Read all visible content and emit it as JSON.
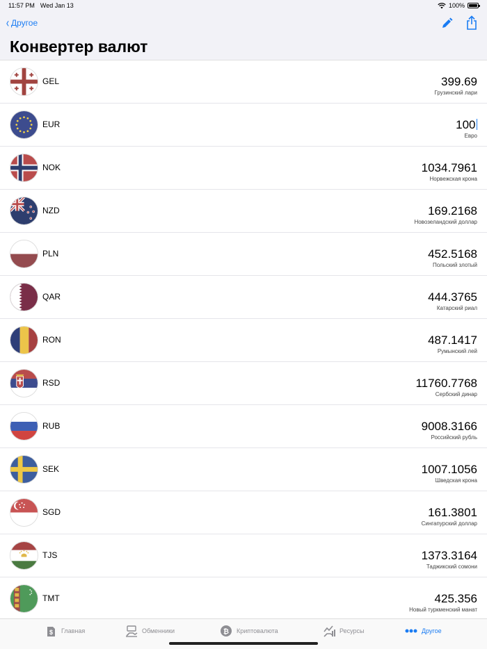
{
  "status": {
    "time": "11:57 PM",
    "date": "Wed Jan 13",
    "battery": "100%"
  },
  "nav": {
    "back_label": "Другое",
    "title": "Конвертер валют"
  },
  "currencies": [
    {
      "code": "GEL",
      "value": "399.69",
      "name": "Грузинский лари",
      "flag": "georgia-flag-icon"
    },
    {
      "code": "EUR",
      "value": "100",
      "name": "Евро",
      "flag": "eu-flag-icon",
      "editing": true
    },
    {
      "code": "NOK",
      "value": "1034.7961",
      "name": "Норвежская крона",
      "flag": "norway-flag-icon"
    },
    {
      "code": "NZD",
      "value": "169.2168",
      "name": "Новозеландский доллар",
      "flag": "new-zealand-flag-icon"
    },
    {
      "code": "PLN",
      "value": "452.5168",
      "name": "Польский злотый",
      "flag": "poland-flag-icon"
    },
    {
      "code": "QAR",
      "value": "444.3765",
      "name": "Катарский риал",
      "flag": "qatar-flag-icon"
    },
    {
      "code": "RON",
      "value": "487.1417",
      "name": "Румынский лей",
      "flag": "romania-flag-icon"
    },
    {
      "code": "RSD",
      "value": "11760.7768",
      "name": "Сербский динар",
      "flag": "serbia-flag-icon"
    },
    {
      "code": "RUB",
      "value": "9008.3166",
      "name": "Российский рубль",
      "flag": "russia-flag-icon"
    },
    {
      "code": "SEK",
      "value": "1007.1056",
      "name": "Шведская крона",
      "flag": "sweden-flag-icon"
    },
    {
      "code": "SGD",
      "value": "161.3801",
      "name": "Сингапурский доллар",
      "flag": "singapore-flag-icon"
    },
    {
      "code": "TJS",
      "value": "1373.3164",
      "name": "Таджикский сомони",
      "flag": "tajikistan-flag-icon"
    },
    {
      "code": "TMT",
      "value": "425.356",
      "name": "Новый туркменский манат",
      "flag": "turkmenistan-flag-icon"
    }
  ],
  "tabs": [
    {
      "label": "Главная",
      "icon": "dollar-doc-icon"
    },
    {
      "label": "Обменники",
      "icon": "exchange-hand-icon"
    },
    {
      "label": "Криптовалюта",
      "icon": "bitcoin-icon"
    },
    {
      "label": "Ресурсы",
      "icon": "chart-hand-icon"
    },
    {
      "label": "Другое",
      "icon": "more-dots-icon",
      "active": true
    }
  ],
  "colors": {
    "accent": "#1a7cf3",
    "background": "#f2f2f7"
  }
}
